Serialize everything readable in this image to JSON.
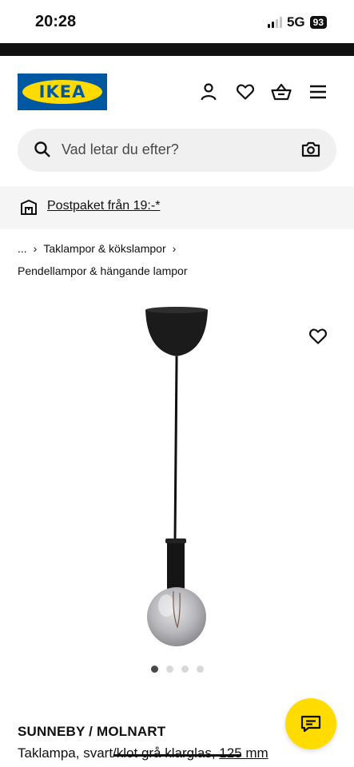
{
  "status": {
    "time": "20:28",
    "network": "5G",
    "battery": "93"
  },
  "header": {
    "logo_text": "IKEA",
    "icons": [
      "user-icon",
      "heart-icon",
      "basket-icon",
      "menu-icon"
    ]
  },
  "search": {
    "placeholder": "Vad letar du efter?",
    "icons": [
      "search-icon",
      "camera-icon"
    ]
  },
  "banner": {
    "text": "Postpaket från 19:-*",
    "icon": "delivery-icon"
  },
  "breadcrumbs": {
    "ellipsis": "...",
    "separator": "›",
    "items": [
      "Taklampor & kökslampor",
      "Pendellampor & hängande lampor"
    ]
  },
  "carousel": {
    "active_index": 0,
    "count": 4
  },
  "product": {
    "name": "SUNNEBY / MOLNART",
    "description": "Taklampa, svart/klot grå klarglas,",
    "size": "125 mm"
  },
  "colors": {
    "ikea_blue": "#0058a3",
    "ikea_yellow": "#ffdb00"
  }
}
